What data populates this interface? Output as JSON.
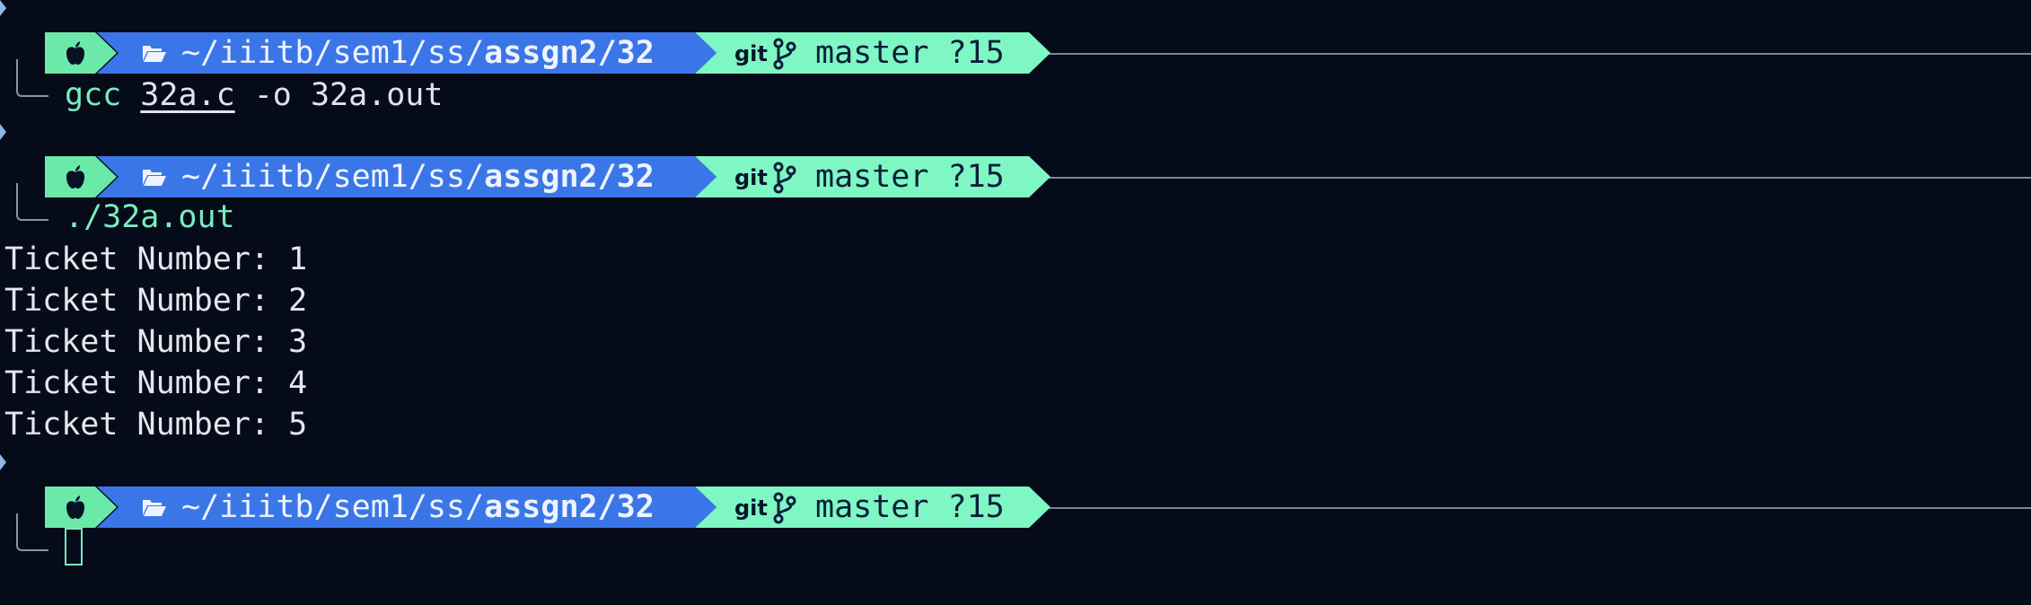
{
  "colors": {
    "background": "#050b18",
    "apple_segment": "#6be9a9",
    "dir_segment": "#3b76e8",
    "git_segment": "#7ef7c4",
    "command_accent": "#78ecc0"
  },
  "icons": {
    "os": "apple-icon",
    "folder": "folder-open-icon",
    "vcs": "git-icon",
    "branch": "git-branch-icon"
  },
  "prompts": [
    {
      "dir_prefix": "~/iiitb/sem1/ss/",
      "dir_bold": "assgn2/32",
      "git_label": "git",
      "branch": "master ?15",
      "command": {
        "program": "gcc",
        "arg_file": "32a.c",
        "rest": " -o 32a.out"
      }
    },
    {
      "dir_prefix": "~/iiitb/sem1/ss/",
      "dir_bold": "assgn2/32",
      "git_label": "git",
      "branch": "master ?15",
      "command": {
        "program": "./32a.out"
      }
    },
    {
      "dir_prefix": "~/iiitb/sem1/ss/",
      "dir_bold": "assgn2/32",
      "git_label": "git",
      "branch": "master ?15"
    }
  ],
  "output_lines": [
    "Ticket Number: 1",
    "Ticket Number: 2",
    "Ticket Number: 3",
    "Ticket Number: 4",
    "Ticket Number: 5"
  ]
}
